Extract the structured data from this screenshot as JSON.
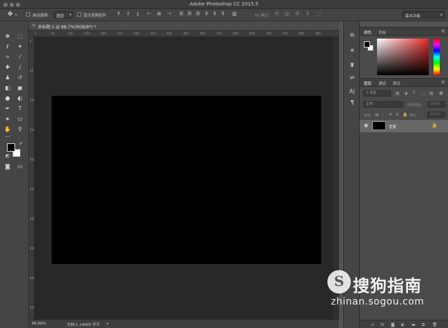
{
  "window": {
    "title": "Adobe Photoshop CC 2015.5"
  },
  "options_bar": {
    "auto_select_label": "自动选择:",
    "auto_select_value": "图层",
    "show_transform_label": "显示变换控件",
    "mode_3d_label": "3D 模式:",
    "workspace": "基本功能"
  },
  "document": {
    "tab_title": "未标题-1 @ 88.7%(RGB/8*) *",
    "canvas_color": "#000000",
    "ruler_h": [
      "0",
      "50",
      "100",
      "150",
      "200",
      "250",
      "300",
      "350",
      "400",
      "450",
      "500",
      "550",
      "600",
      "650",
      "700",
      "750",
      "800",
      "850"
    ],
    "ruler_v": [
      "0",
      "50",
      "100",
      "150",
      "200",
      "250",
      "300",
      "350",
      "400",
      "450"
    ]
  },
  "status_bar": {
    "zoom": "88.69%",
    "doc_info": "文档:1.14M/0 字节"
  },
  "color_panel": {
    "tab_color": "颜色",
    "tab_swatches": "色板"
  },
  "layers_panel": {
    "tab_layers": "图层",
    "tab_channels": "通道",
    "tab_paths": "路径",
    "kind_filter": "类型",
    "blend_mode": "正常",
    "opacity_label": "不透明度:",
    "opacity_value": "100%",
    "lock_label": "锁定:",
    "fill_label": "填充:",
    "fill_value": "100%",
    "layer_name": "背景"
  },
  "watermark": {
    "logo_letter": "S",
    "brand": "搜狗指南",
    "url": "zhinan.sogou.com"
  }
}
